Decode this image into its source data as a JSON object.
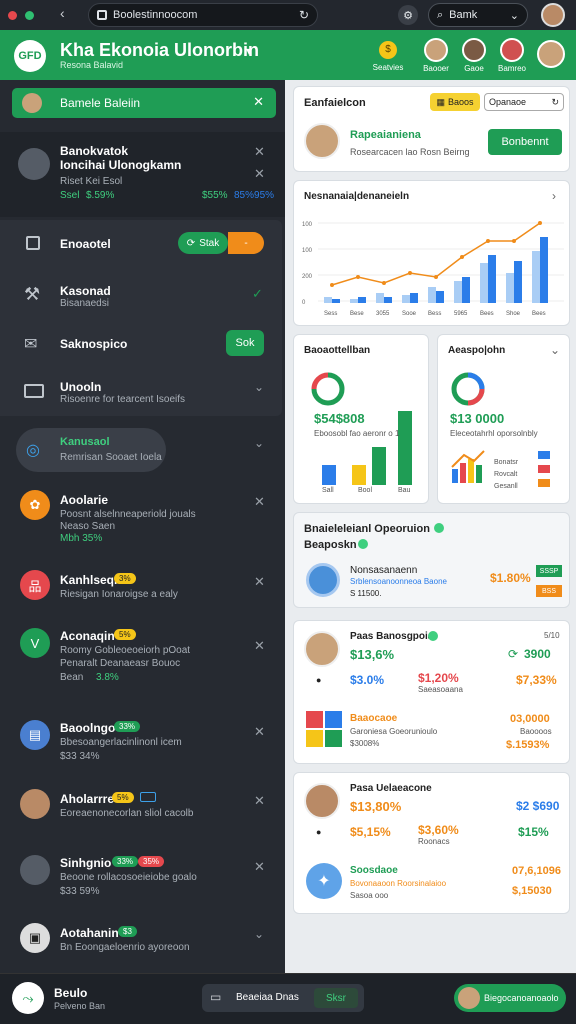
{
  "browser": {
    "url": "Boolestinnoocom",
    "search_label": "Bamk"
  },
  "header": {
    "title": "Kha Ekonoia Ulonorbin",
    "subtitle": "Resona Balavid",
    "logo_text": "GFD",
    "items": [
      {
        "label": "Seatvies"
      },
      {
        "label": "Baooer"
      },
      {
        "label": "Gaoe"
      },
      {
        "label": "Bamreo"
      }
    ]
  },
  "sidebar": {
    "active_bar": "Bamele Baleiin",
    "top_item": {
      "title": "Banokvatok",
      "title2": "Ioncihai Ulonogkamn",
      "sub": "Riset Kei Esol",
      "left_val": "Ssel",
      "left_pct": "$.59%",
      "right_pct": "$55%",
      "right_val": "85%95%"
    },
    "rows": [
      {
        "label": "Enoaotel",
        "btn1": "Stak",
        "btn2": "-"
      },
      {
        "label": "Kasonad",
        "sub": "Bisanaedsi"
      },
      {
        "label": "Saknospico",
        "btn": "Sok"
      },
      {
        "label": "Unooln",
        "sub": "Risoenre for tearcent Isoeifs"
      }
    ],
    "feed": [
      {
        "title": "Kanusaol",
        "sub": "Remrisan Sooaet Ioela"
      },
      {
        "title": "Aoolarie",
        "sub": "Poosnt alselnneaperiold jouals",
        "sub2": "Neaso Saen",
        "val": "Mbh 35%"
      },
      {
        "title": "Kanhlseqn",
        "badge": "3%",
        "sub": "Riesigan Ionaroigse a ealy"
      },
      {
        "title": "Aconaqin",
        "badge": "5%",
        "sub": "Roomy Gobleoeoeiorh pOoat",
        "sub2": "Penaralt Deanaeasr Bouoc",
        "val": "Bean",
        "val2": "3.8%"
      },
      {
        "title": "Baoolngo",
        "badge": "33%",
        "sub": "Bbesoangerlacinlinonl icem",
        "sub2": "$33 34%"
      },
      {
        "title": "Aholarrre",
        "badge": "5%",
        "sub": "Eoreaenonecorlan sliol cacolb"
      },
      {
        "title": "Sinhgnio",
        "badge": "33%",
        "badge2": "35%",
        "sub": "Beoone rollacosoeieiobe goalo",
        "sub2": "$33 59%"
      },
      {
        "title": "Aotahanin",
        "badge": "$3",
        "sub": "Bn Eoongaeloenrio ayoreoon"
      }
    ]
  },
  "main": {
    "profile_card": {
      "title": "Eanfaielcon",
      "btn1": "Baoos",
      "btn2": "Opanaoe",
      "name": "Rapeaianiena",
      "sub": "Rosearcacen lao Rosn Beirng",
      "action": "Bonbennt"
    },
    "bar_card": {
      "title": "Nesnanaia|denaneieln",
      "ticks": [
        "100",
        "100",
        "200",
        "0"
      ],
      "labels": [
        "Sess",
        "Bese",
        "3055",
        "Sooe",
        "Bess",
        "5965",
        "Bees",
        "Shoe",
        "Bees"
      ]
    },
    "small1": {
      "title": "Baoaottellban",
      "value": "$54$808",
      "sub": "Eboosobl fao aeronr o 1",
      "labels": [
        "Sall",
        "Bool",
        "Bau"
      ]
    },
    "small2": {
      "title": "Aeaspo|ohn",
      "value": "$13 0000",
      "sub": "Eleceotahrhl oporsolnbly",
      "legend": [
        "Bonatsr",
        "Rovcalt",
        "Gesanll"
      ]
    },
    "op_card": {
      "title": "Bnaieleleianl Opeoruion",
      "title2": "Beaposkn",
      "name": "Nonsasanaenn",
      "sub": "Srblensoanoonneoa Baone",
      "sub2": "S 11500.",
      "pct": "$1.80%",
      "tag1": "SSSP",
      "tag2": "BSS"
    },
    "stat1": {
      "name": "Paas Banosgpoia",
      "date": "5/10",
      "v1": "$13,6%",
      "v2": "3900",
      "r1": "$3.0%",
      "r2": "$1,20%",
      "r3": "$7,33%",
      "rsub": "Saeasoaana",
      "name2": "Baaocaoe",
      "sub2": "Garoniesa Goeorunioulo",
      "sub3": "$3008%",
      "r4": "03,0000",
      "r5": "Baoooos",
      "r6": "$.1593%"
    },
    "stat2": {
      "name": "Pasa Uelaeacone",
      "v1": "$13,80%",
      "v2": "$2 $690",
      "r1": "$5,15%",
      "r2": "$3,60%",
      "rsub": "Roonacs",
      "r3": "$15%",
      "name2": "Soosdaoe",
      "sub2": "Bovonaaoon Roorsinalaioo",
      "sub3": "Sasoa ooo",
      "r4": "07,6,1096",
      "r5": "$,15030"
    }
  },
  "bottom": {
    "user": "Beulo",
    "user_sub": "Pelveno Ban",
    "pill": "Beaeiaa Dnas",
    "pill_tag": "Sksr",
    "cta": "Biegocanoanoaolo"
  },
  "colors": {
    "green": "#1f9d55",
    "orange": "#f08c1a",
    "blue": "#2b7de9"
  }
}
